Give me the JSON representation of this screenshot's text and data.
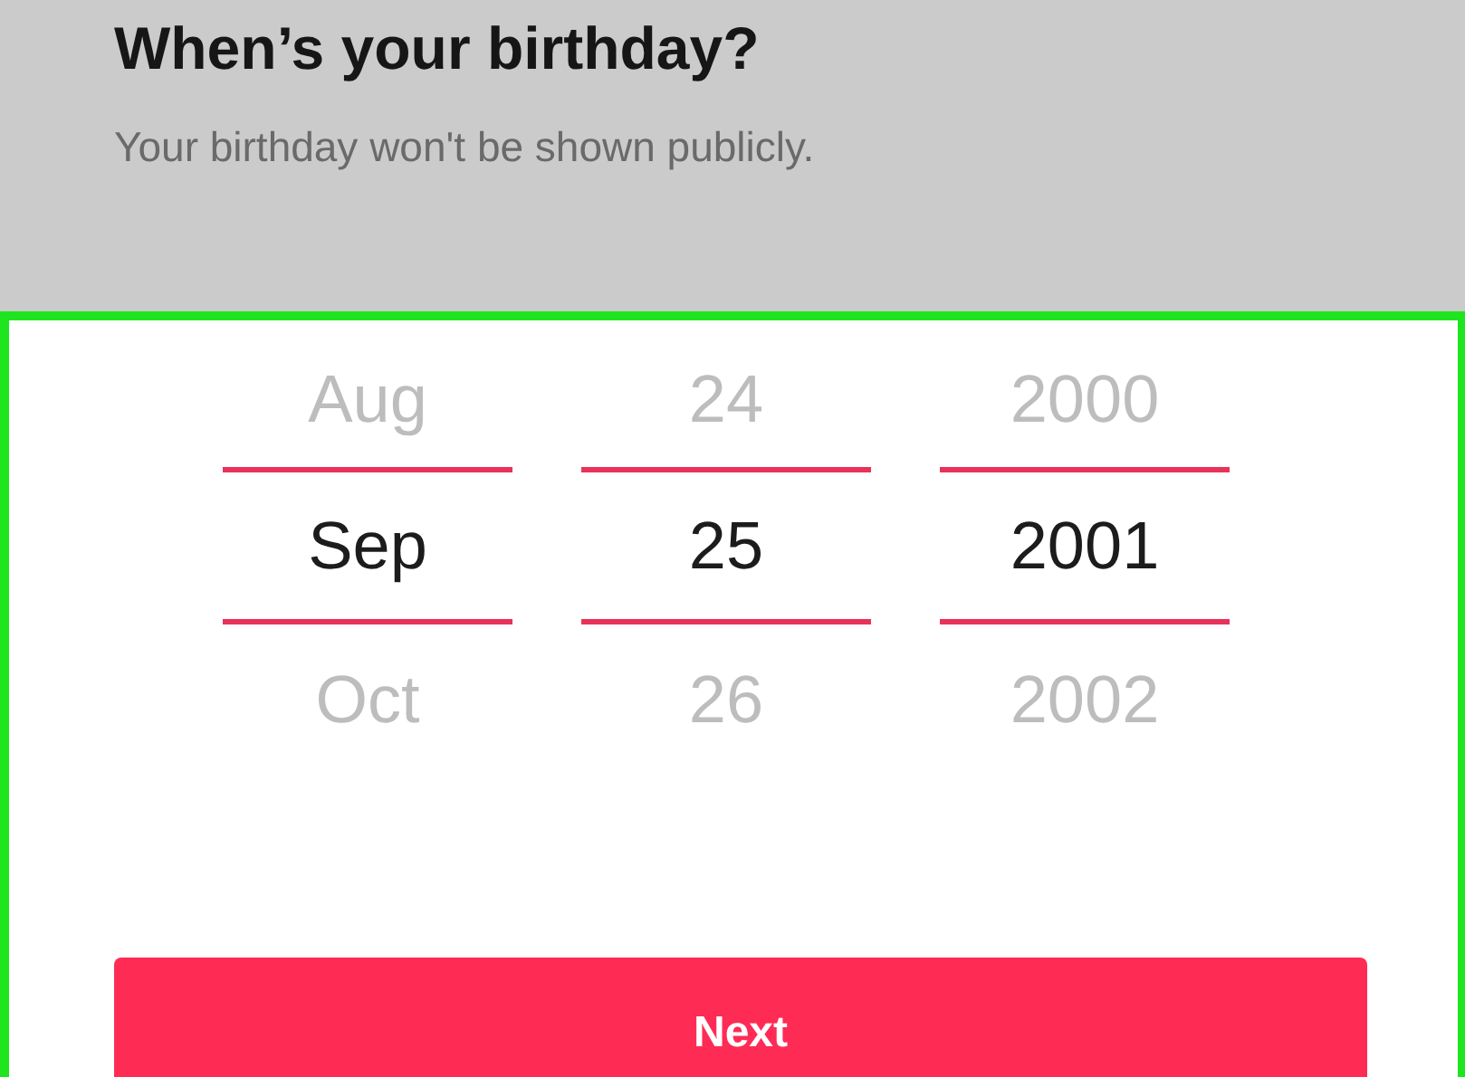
{
  "title": "When’s your birthday?",
  "subtitle": "Your birthday won't be shown publicly.",
  "picker": {
    "columns": [
      {
        "items": [
          {
            "label": "Aug",
            "selected": false
          },
          {
            "label": "Sep",
            "selected": true
          },
          {
            "label": "Oct",
            "selected": false
          }
        ]
      },
      {
        "items": [
          {
            "label": "24",
            "selected": false
          },
          {
            "label": "25",
            "selected": true
          },
          {
            "label": "26",
            "selected": false
          }
        ]
      },
      {
        "items": [
          {
            "label": "2000",
            "selected": false
          },
          {
            "label": "2001",
            "selected": true
          },
          {
            "label": "2002",
            "selected": false
          }
        ]
      }
    ]
  },
  "next_button": {
    "label": "Next"
  }
}
